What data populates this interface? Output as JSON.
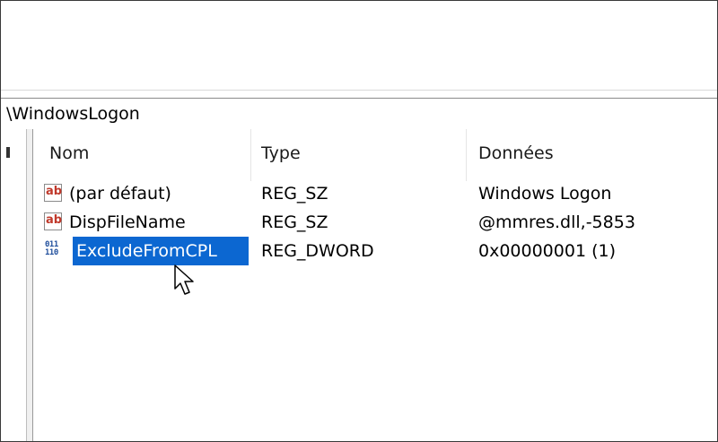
{
  "address_bar": {
    "path": "\\WindowsLogon"
  },
  "columns": {
    "name": "Nom",
    "type": "Type",
    "data": "Données"
  },
  "rows": [
    {
      "name": "(par défaut)",
      "type": "REG_SZ",
      "data": "Windows Logon",
      "icon": "string-value-icon",
      "icon_text": "ab"
    },
    {
      "name": "DispFileName",
      "type": "REG_SZ",
      "data": "@mmres.dll,-5853",
      "icon": "string-value-icon",
      "icon_text": "ab"
    },
    {
      "name": "ExcludeFromCPL",
      "type": "REG_DWORD",
      "data": "0x00000001 (1)",
      "icon": "binary-value-icon",
      "icon_text": "011\n110",
      "selected": true
    }
  ],
  "colors": {
    "selection": "#0c67d1",
    "string_icon": "#c0392b",
    "binary_icon": "#1f4e9c"
  }
}
